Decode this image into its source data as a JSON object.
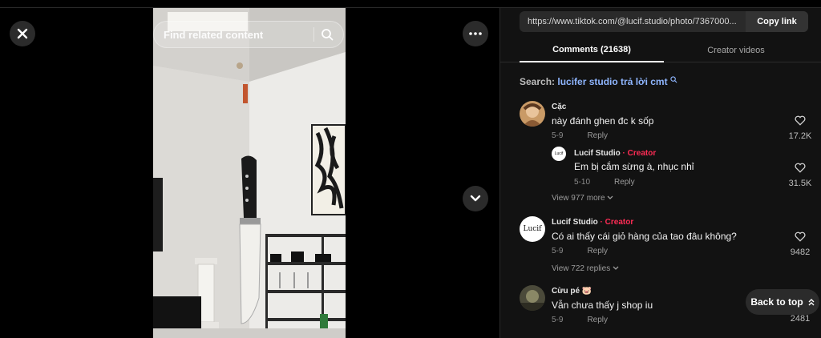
{
  "viewer": {
    "find_placeholder": "Find related content",
    "icons": {
      "close": "close-icon",
      "more": "more-icon",
      "search": "search-icon",
      "next": "chevron-down-icon"
    }
  },
  "panel": {
    "url": "https://www.tiktok.com/@lucif.studio/photo/7367000...",
    "copy_label": "Copy link",
    "tabs": [
      {
        "label": "Comments (21638)",
        "active": true
      },
      {
        "label": "Creator videos",
        "active": false
      }
    ],
    "search": {
      "prefix": "Search:",
      "query": "lucifer studio trả lời cmt"
    },
    "comments": [
      {
        "name": "Cặc",
        "tag": "",
        "text": "này đánh ghen đc k sốp",
        "date": "5-9",
        "reply": "Reply",
        "likes": "17.2K",
        "replies": [
          {
            "name": "Lucif Studio",
            "tag": "Creator",
            "text": "Em bị cắm sừng à, nhục nhỉ",
            "date": "5-10",
            "reply": "Reply",
            "likes": "31.5K"
          }
        ],
        "view_more": "View 977 more"
      },
      {
        "name": "Lucif Studio",
        "tag": "Creator",
        "text": "Có ai thấy cái giỏ hàng của tao đâu không?",
        "date": "5-9",
        "reply": "Reply",
        "likes": "9482",
        "view_more": "View 722 replies"
      },
      {
        "name": "Cừu pé 🐷",
        "tag": "",
        "text": "Vẫn chưa thấy j shop iu",
        "date": "5-9",
        "reply": "Reply",
        "likes": "2481"
      }
    ],
    "back_to_top": "Back to top",
    "tag_separator": " · ",
    "avatar_text": "Lucif"
  },
  "colors": {
    "creator_tag": "#fe2c55",
    "search_query": "#8fb6ff",
    "panel_bg": "#121212"
  }
}
